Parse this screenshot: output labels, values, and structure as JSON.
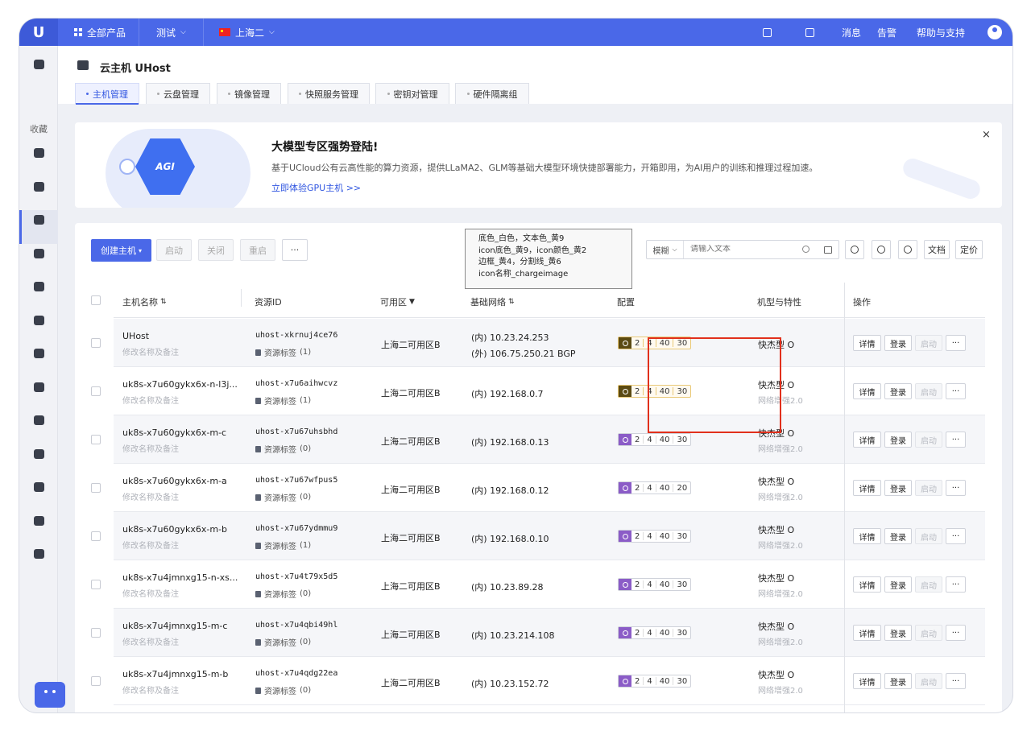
{
  "topbar": {
    "all_products": "全部产品",
    "project": "测试",
    "region": "上海二",
    "messages": "消息",
    "alerts": "告警",
    "help": "帮助与支持"
  },
  "sidebar": {
    "favorites": "收藏"
  },
  "page": {
    "title": "云主机 UHost",
    "tabs": [
      "主机管理",
      "云盘管理",
      "镜像管理",
      "快照服务管理",
      "密钥对管理",
      "硬件隔离组"
    ]
  },
  "banner": {
    "agi": "AGI",
    "title": "大模型专区强势登陆!",
    "desc": "基于UCloud公有云高性能的算力资源，提供LLaMA2、GLM等基础大模型环境快捷部署能力，开箱即用，为AI用户的训练和推理过程加速。",
    "link": "立即体验GPU主机 >>",
    "close": "×"
  },
  "toolbar": {
    "create": "创建主机",
    "start": "启动",
    "stop": "关闭",
    "restart": "重启",
    "more": "···",
    "search_mode": "模糊",
    "search_placeholder": "请输入文本",
    "doc": "文档",
    "pricing": "定价"
  },
  "annotation": {
    "line1": "底色_白色，文本色_黄9",
    "line2": "icon底色_黄9，icon颜色_黄2",
    "line3": "边框_黄4，分割线_黄6",
    "line4": "icon名称_chargeimage"
  },
  "table": {
    "headers": [
      "主机名称",
      "资源ID",
      "可用区",
      "基础网络",
      "配置",
      "机型与特性",
      "操作"
    ],
    "edit_hint": "修改名称及备注",
    "tag_label": "资源标签",
    "actions": {
      "detail": "详情",
      "login": "登录",
      "start": "启动",
      "more": "···"
    },
    "rows": [
      {
        "name": "UHost",
        "id": "uhost-xkrnuj4ce76",
        "tags": "(1)",
        "zone": "上海二可用区B",
        "net1": "(内) 10.23.24.253",
        "net2": "(外) 106.75.250.21 BGP",
        "spec": [
          "2",
          "4",
          "40",
          "30"
        ],
        "type": "快杰型 O",
        "feature": ""
      },
      {
        "name": "uk8s-x7u60gykx6x-n-l3j...",
        "id": "uhost-x7u6aihwcvz",
        "tags": "(1)",
        "zone": "上海二可用区B",
        "net1": "(内) 192.168.0.7",
        "net2": "",
        "spec": [
          "2",
          "4",
          "40",
          "30"
        ],
        "type": "快杰型 O",
        "feature": "网络增强2.0"
      },
      {
        "name": "uk8s-x7u60gykx6x-m-c",
        "id": "uhost-x7u67uhsbhd",
        "tags": "(0)",
        "zone": "上海二可用区B",
        "net1": "(内) 192.168.0.13",
        "net2": "",
        "spec": [
          "2",
          "4",
          "40",
          "30"
        ],
        "type": "快杰型 O",
        "feature": "网络增强2.0"
      },
      {
        "name": "uk8s-x7u60gykx6x-m-a",
        "id": "uhost-x7u67wfpus5",
        "tags": "(0)",
        "zone": "上海二可用区B",
        "net1": "(内) 192.168.0.12",
        "net2": "",
        "spec": [
          "2",
          "4",
          "40",
          "20"
        ],
        "type": "快杰型 O",
        "feature": "网络增强2.0"
      },
      {
        "name": "uk8s-x7u60gykx6x-m-b",
        "id": "uhost-x7u67ydmmu9",
        "tags": "(1)",
        "zone": "上海二可用区B",
        "net1": "(内) 192.168.0.10",
        "net2": "",
        "spec": [
          "2",
          "4",
          "40",
          "30"
        ],
        "type": "快杰型 O",
        "feature": "网络增强2.0"
      },
      {
        "name": "uk8s-x7u4jmnxg15-n-xs...",
        "id": "uhost-x7u4t79x5d5",
        "tags": "(0)",
        "zone": "上海二可用区B",
        "net1": "(内) 10.23.89.28",
        "net2": "",
        "spec": [
          "2",
          "4",
          "40",
          "30"
        ],
        "type": "快杰型 O",
        "feature": "网络增强2.0"
      },
      {
        "name": "uk8s-x7u4jmnxg15-m-c",
        "id": "uhost-x7u4qbi49hl",
        "tags": "(0)",
        "zone": "上海二可用区B",
        "net1": "(内) 10.23.214.108",
        "net2": "",
        "spec": [
          "2",
          "4",
          "40",
          "30"
        ],
        "type": "快杰型 O",
        "feature": "网络增强2.0"
      },
      {
        "name": "uk8s-x7u4jmnxg15-m-b",
        "id": "uhost-x7u4qdg22ea",
        "tags": "(0)",
        "zone": "上海二可用区B",
        "net1": "(内) 10.23.152.72",
        "net2": "",
        "spec": [
          "2",
          "4",
          "40",
          "30"
        ],
        "type": "快杰型 O",
        "feature": "网络增强2.0"
      }
    ]
  },
  "colors": {
    "brand": "#4a68e8",
    "gold_icon_bg": "#5b4a12",
    "purple_icon_bg": "#8b5cc7",
    "highlight": "#e1301c"
  }
}
